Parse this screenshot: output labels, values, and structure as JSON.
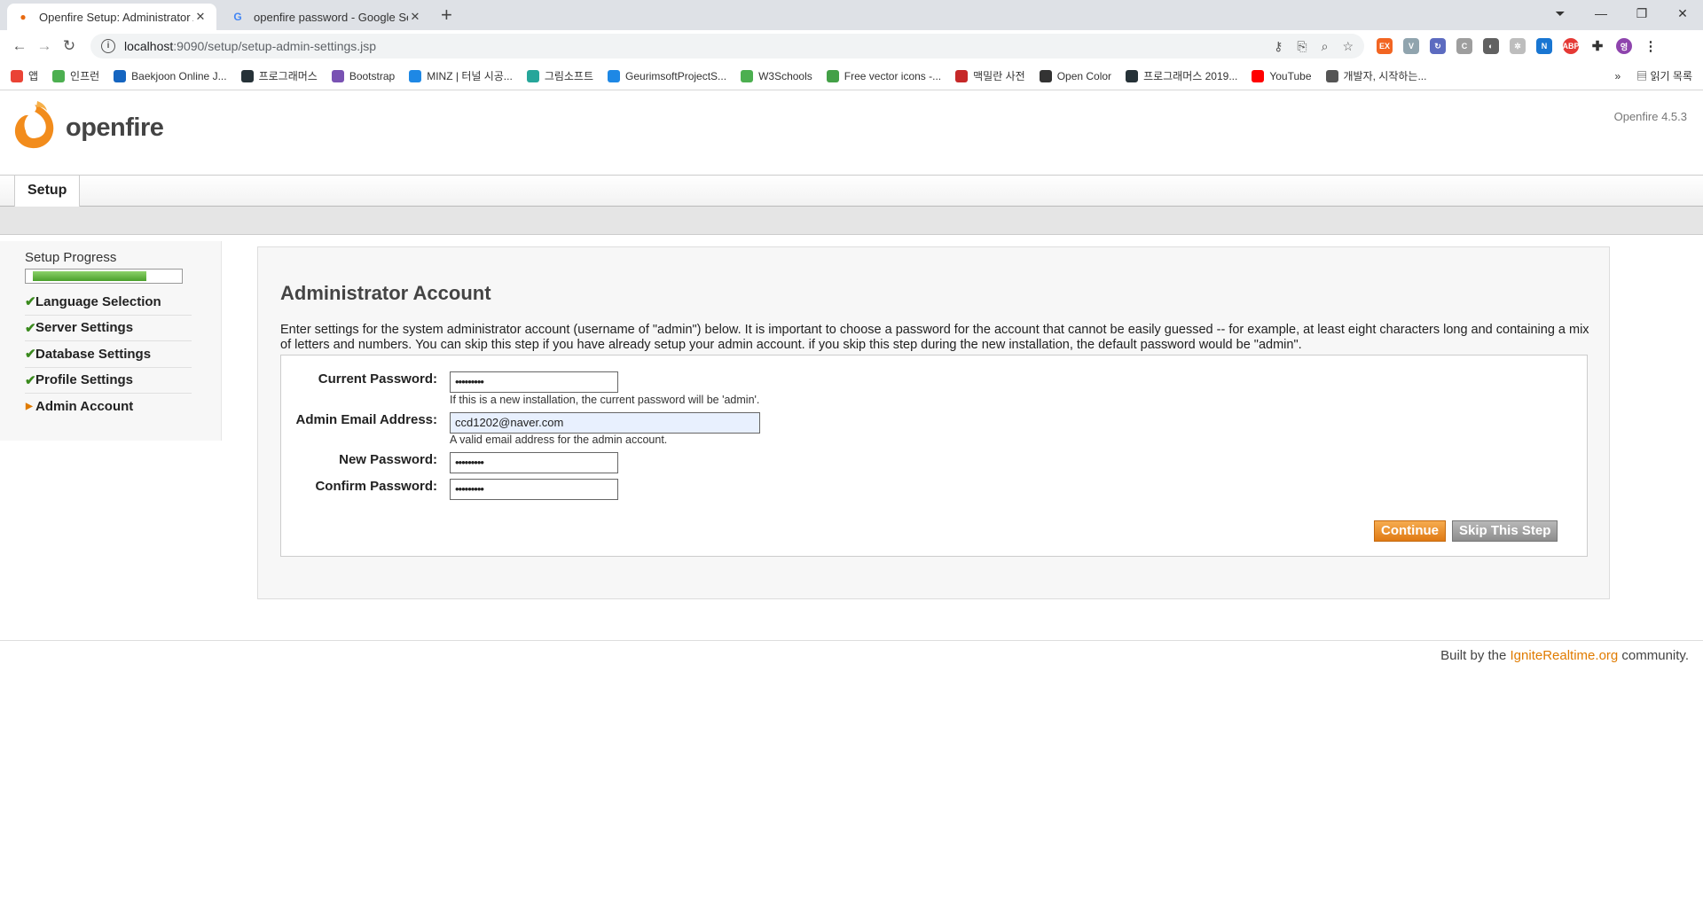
{
  "browser": {
    "tabs": [
      {
        "title": "Openfire Setup: Administrator A",
        "active": true
      },
      {
        "title": "openfire password - Google Se",
        "active": false
      }
    ],
    "url_host": "localhost",
    "url_path": ":9090/setup/setup-admin-settings.jsp",
    "bookmarks": [
      {
        "label": "앱",
        "color": "#ea4335"
      },
      {
        "label": "인프런",
        "color": "#4caf50"
      },
      {
        "label": "Baekjoon Online J...",
        "color": "#1565c0"
      },
      {
        "label": "프로그래머스",
        "color": "#263238"
      },
      {
        "label": "Bootstrap",
        "color": "#7952b3"
      },
      {
        "label": "MINZ | 터널 시공...",
        "color": "#1e88e5"
      },
      {
        "label": "그림소프트",
        "color": "#26a69a"
      },
      {
        "label": "GeurimsoftProjectS...",
        "color": "#1e88e5"
      },
      {
        "label": "W3Schools",
        "color": "#4caf50"
      },
      {
        "label": "Free vector icons -...",
        "color": "#43a047"
      },
      {
        "label": "맥밀란 사전",
        "color": "#c62828"
      },
      {
        "label": "Open Color",
        "color": "#333333"
      },
      {
        "label": "프로그래머스 2019...",
        "color": "#263238"
      },
      {
        "label": "YouTube",
        "color": "#ff0000"
      },
      {
        "label": "개발자, 시작하는...",
        "color": "#555555"
      }
    ],
    "reading_list": "읽기 목록"
  },
  "header": {
    "logo_text": "openfire",
    "version": "Openfire 4.5.3"
  },
  "nav": {
    "tab_label": "Setup"
  },
  "sidebar": {
    "progress_label": "Setup Progress",
    "progress_fraction": 0.8,
    "steps": [
      {
        "label": "Language Selection",
        "done": true
      },
      {
        "label": "Server Settings",
        "done": true
      },
      {
        "label": "Database Settings",
        "done": true
      },
      {
        "label": "Profile Settings",
        "done": true
      },
      {
        "label": "Admin Account",
        "done": false
      }
    ]
  },
  "main": {
    "heading": "Administrator Account",
    "intro": "Enter settings for the system administrator account (username of \"admin\") below. It is important to choose a password for the account that cannot be easily guessed -- for example, at least eight characters long and containing a mix of letters and numbers. You can skip this step if you have already setup your admin account. if you skip this step during the new installation, the default password would be \"admin\".",
    "form": {
      "current_password_label": "Current Password:",
      "current_password_value": "•••••••••",
      "current_password_hint": "If this is a new installation, the current password will be 'admin'.",
      "email_label": "Admin Email Address:",
      "email_value": "ccd1202@naver.com",
      "email_hint": "A valid email address for the admin account.",
      "new_password_label": "New Password:",
      "new_password_value": "•••••••••",
      "confirm_password_label": "Confirm Password:",
      "confirm_password_value": "•••••••••"
    },
    "buttons": {
      "continue": "Continue",
      "skip": "Skip This Step"
    }
  },
  "footer": {
    "prefix": "Built by the ",
    "link": "IgniteRealtime.org",
    "suffix": " community."
  }
}
